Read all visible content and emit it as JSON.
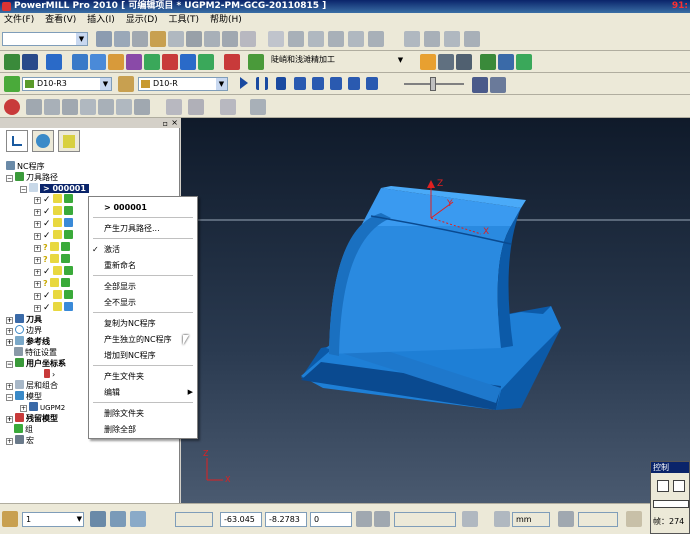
{
  "window": {
    "title": "PowerMILL Pro 2010    [ 可编辑项目 * UGPM2-PM-GCG-20110815 ]",
    "right_text": "91:"
  },
  "menu": [
    "文件(F)",
    "查看(V)",
    "插入(I)",
    "显示(D)",
    "工具(T)",
    "帮助(H)"
  ],
  "toolbar": {
    "strategy_label": "陡峭和浅滩精加工",
    "tool_combo": "D10-R3",
    "holder_combo": "D10-R"
  },
  "explorer": {
    "tree": [
      {
        "label": "NC程序"
      },
      {
        "label": "刀具路径"
      },
      {
        "label": "> 000001"
      },
      {
        "label": "刀具"
      },
      {
        "label": "边界"
      },
      {
        "label": "参考线"
      },
      {
        "label": "特征设置"
      },
      {
        "label": "用户坐标系"
      },
      {
        "label": "层和组合"
      },
      {
        "label": "模型"
      },
      {
        "label": "UGPM2"
      },
      {
        "label": "残留模型"
      },
      {
        "label": "组"
      },
      {
        "label": "宏"
      }
    ]
  },
  "context_menu": {
    "header": "> 000001",
    "items": [
      "产生刀具路径...",
      "激活",
      "重新命名",
      "全部显示",
      "全不显示",
      "复制为NC程序",
      "产生独立的NC程序",
      "增加到NC程序",
      "产生文件夹",
      "编辑",
      "删除文件夹",
      "删除全部"
    ]
  },
  "axes": {
    "x": "X",
    "y": "Y",
    "z": "Z",
    "triad_x": "X",
    "triad_z": "Z"
  },
  "status": {
    "layer_value": "1",
    "coord_x": "-63.045",
    "coord_y": "-8.2783",
    "coord_z": "0",
    "units": "mm"
  },
  "control_panel": {
    "title": "控制",
    "label": "帧：",
    "value": "274"
  },
  "colors": {
    "model": "#1e7fd6",
    "model_dark": "#0c5aa8",
    "viewport_bg": "#1a2638",
    "axis_red": "#e02020"
  }
}
